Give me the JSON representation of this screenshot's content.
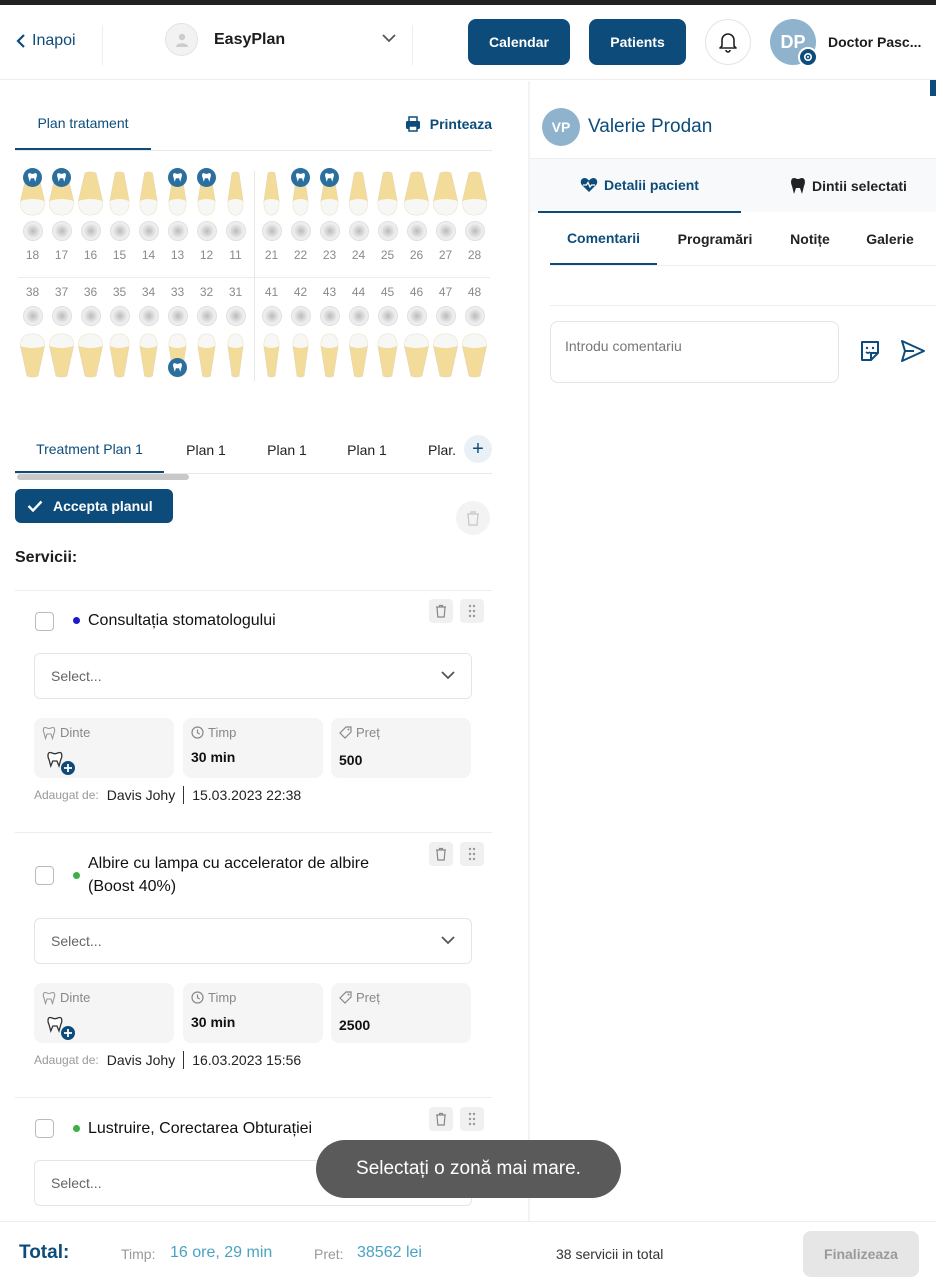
{
  "header": {
    "back_label": "Inapoi",
    "clinic_name": "EasyPlan",
    "calendar_label": "Calendar",
    "patients_label": "Patients",
    "user_initials": "DP",
    "user_name": "Doctor Pasc..."
  },
  "plan_header": {
    "tab_label": "Plan tratament",
    "print_label": "Printeaza"
  },
  "teeth": {
    "upper": [
      18,
      17,
      16,
      15,
      14,
      13,
      12,
      11,
      21,
      22,
      23,
      24,
      25,
      26,
      27,
      28
    ],
    "lower": [
      38,
      37,
      36,
      35,
      34,
      33,
      32,
      31,
      41,
      42,
      43,
      44,
      45,
      46,
      47,
      48
    ],
    "upper_badged": [
      18,
      17,
      13,
      12,
      22,
      23
    ],
    "lower_badged": [
      33
    ]
  },
  "plan_tabs": [
    "Treatment Plan 1",
    "Plan 1",
    "Plan 1",
    "Plan 1",
    "Plar."
  ],
  "accept_label": "Accepta planul",
  "services_label": "Servicii:",
  "field_labels": {
    "teeth": "Dinte",
    "time": "Timp",
    "price": "Preț",
    "added_by": "Adaugat de:"
  },
  "select_placeholder": "Select...",
  "services": [
    {
      "title": "Consultația stomatologului",
      "dot_color": "#1a1ac8",
      "time": "30 min",
      "price": "500",
      "author": "Davis Johy",
      "date": "15.03.2023 22:38"
    },
    {
      "title": "Albire cu lampa cu accelerator de albire (Boost 40%)",
      "dot_color": "#3cb043",
      "time": "30 min",
      "price": "2500",
      "author": "Davis Johy",
      "date": "16.03.2023 15:56"
    },
    {
      "title": "Lustruire, Corectarea Obturației",
      "dot_color": "#3cb043"
    }
  ],
  "patient": {
    "initials": "VP",
    "name": "Valerie Prodan",
    "tabs": [
      "Detalii pacient",
      "Dintii selectati"
    ],
    "subtabs": [
      "Comentarii",
      "Programări",
      "Notițe",
      "Galerie"
    ],
    "comment_placeholder": "Introdu comentariu"
  },
  "footer": {
    "total_label": "Total:",
    "time_label": "Timp:",
    "time_value": "16 ore, 29 min",
    "price_label": "Pret:",
    "price_value": "38562 lei",
    "services_count": "38 servicii in total",
    "finish_label": "Finalizeaza"
  },
  "toast": "Selectați o zonă mai mare.",
  "colors": {
    "primary": "#0d4c7a",
    "accent": "#4aa3c4"
  }
}
